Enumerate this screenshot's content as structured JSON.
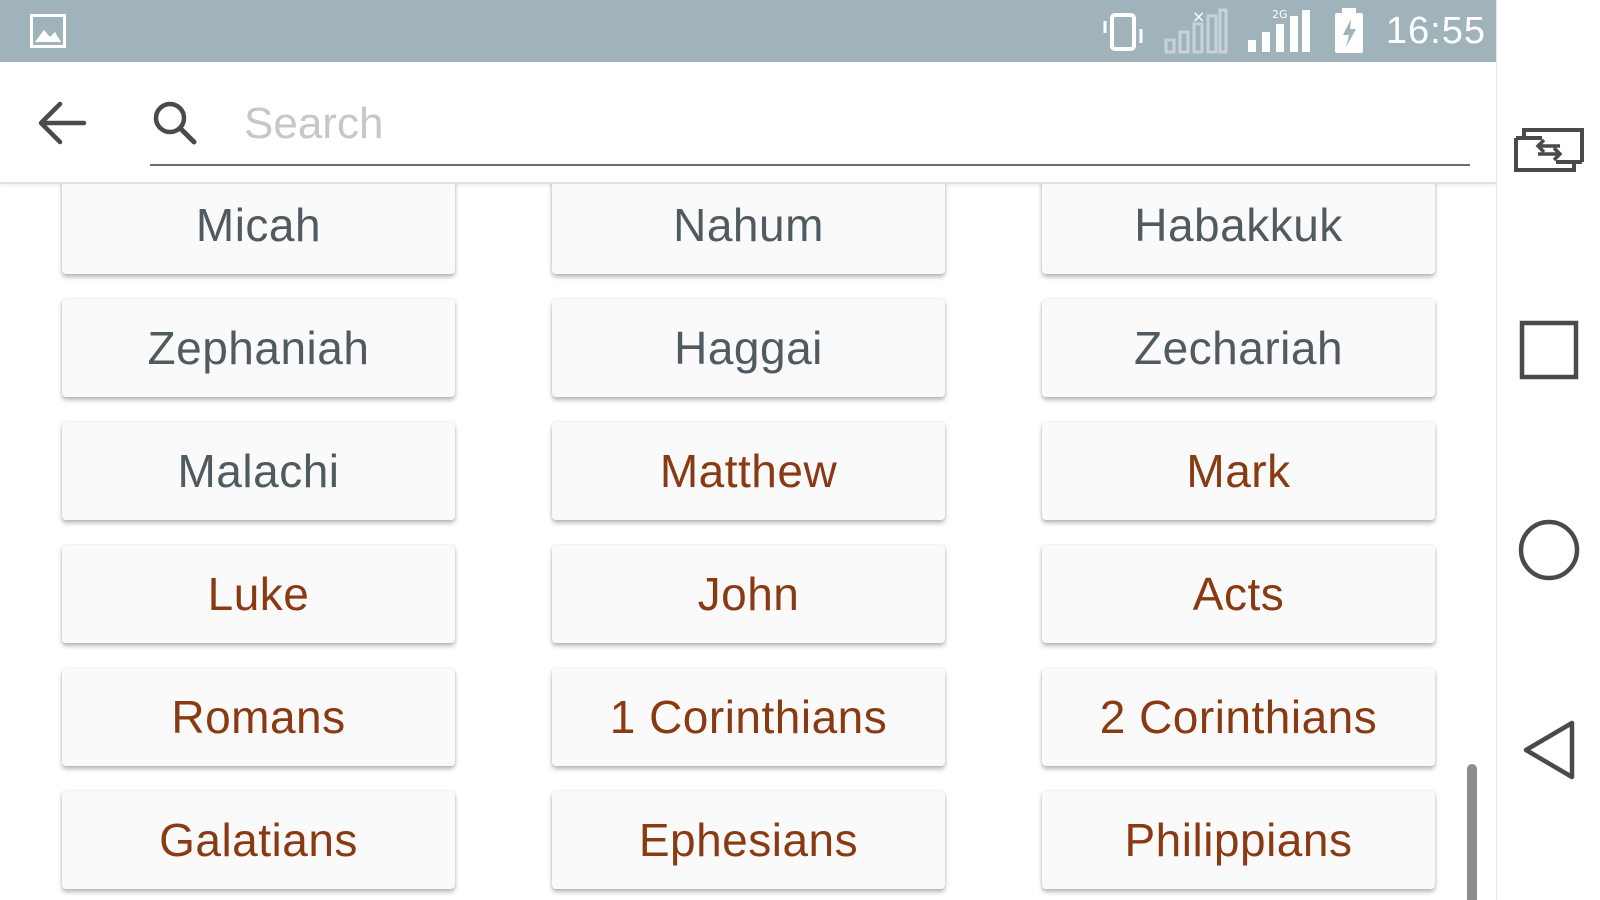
{
  "status_bar": {
    "time": "16:55",
    "icons": [
      "gallery-icon",
      "vibrate-icon",
      "signal-no-service-icon",
      "signal-2g-icon",
      "battery-icon"
    ],
    "network_label": "2G"
  },
  "search": {
    "placeholder": "Search",
    "value": ""
  },
  "books": [
    {
      "name": "Micah",
      "testament": "ot"
    },
    {
      "name": "Nahum",
      "testament": "ot"
    },
    {
      "name": "Habakkuk",
      "testament": "ot"
    },
    {
      "name": "Zephaniah",
      "testament": "ot"
    },
    {
      "name": "Haggai",
      "testament": "ot"
    },
    {
      "name": "Zechariah",
      "testament": "ot"
    },
    {
      "name": "Malachi",
      "testament": "ot"
    },
    {
      "name": "Matthew",
      "testament": "nt"
    },
    {
      "name": "Mark",
      "testament": "nt"
    },
    {
      "name": "Luke",
      "testament": "nt"
    },
    {
      "name": "John",
      "testament": "nt"
    },
    {
      "name": "Acts",
      "testament": "nt"
    },
    {
      "name": "Romans",
      "testament": "nt"
    },
    {
      "name": "1 Corinthians",
      "testament": "nt"
    },
    {
      "name": "2 Corinthians",
      "testament": "nt"
    },
    {
      "name": "Galatians",
      "testament": "nt"
    },
    {
      "name": "Ephesians",
      "testament": "nt"
    },
    {
      "name": "Philippians",
      "testament": "nt"
    }
  ],
  "colors": {
    "status_bar": "#a0b3bb",
    "old_testament_text": "#4f5b60",
    "new_testament_text": "#8a3a12"
  },
  "navigation": [
    "screen-switch-icon",
    "recents-icon",
    "home-icon",
    "back-triangle-icon"
  ]
}
